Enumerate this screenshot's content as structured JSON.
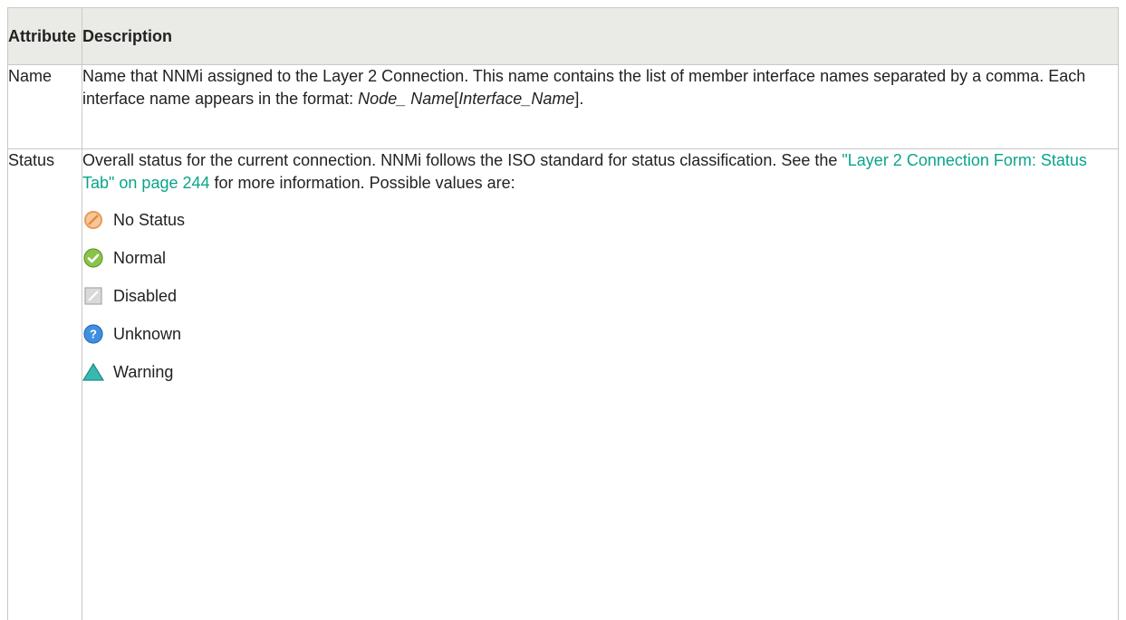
{
  "table": {
    "headers": {
      "attribute": "Attribute",
      "description": "Description"
    },
    "rows": {
      "name": {
        "attribute": "Name",
        "desc_part1": "Name that NNMi assigned to the Layer 2 Connection. This name contains the list of member interface names separated by a comma. Each interface name appears in the format: ",
        "desc_em1": "Node_",
        "desc_em2": "Name",
        "desc_bracket_open": "[",
        "desc_em3": "Interface_Name",
        "desc_bracket_close": "]."
      },
      "status": {
        "attribute": "Status",
        "desc_part1": "Overall status for the current connection. NNMi follows the ISO standard for status classification. See the ",
        "link_text": "\"Layer 2 Connection Form: Status Tab\" on page 244",
        "desc_part2": " for more information. Possible values are:",
        "values": [
          {
            "label": "No Status",
            "icon": "no-status-icon"
          },
          {
            "label": "Normal",
            "icon": "normal-icon"
          },
          {
            "label": "Disabled",
            "icon": "disabled-icon"
          },
          {
            "label": "Unknown",
            "icon": "unknown-icon"
          },
          {
            "label": "Warning",
            "icon": "warning-icon"
          }
        ]
      }
    }
  },
  "colors": {
    "header_bg": "#eaeae7",
    "border": "#c9c9c9",
    "link": "#0aa48a"
  }
}
